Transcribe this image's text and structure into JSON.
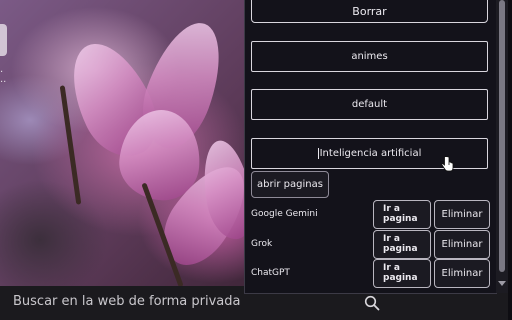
{
  "popup": {
    "borrar_label": "Borrar",
    "buttons": [
      "animes",
      "default",
      "Inteligencia artificial"
    ],
    "open_pages_label": "abrir paginas",
    "sites": [
      {
        "name": "Google Gemini",
        "go_label": "Ir a pagina",
        "delete_label": "Eliminar"
      },
      {
        "name": "Grok",
        "go_label": "Ir a pagina",
        "delete_label": "Eliminar"
      },
      {
        "name": "ChatGPT",
        "go_label": "Ir a pagina",
        "delete_label": "Eliminar"
      }
    ]
  },
  "search": {
    "placeholder": "Buscar en la web de forma privada"
  },
  "icons": {
    "search": "search-icon",
    "cursor": "hand-cursor-icon"
  },
  "colors": {
    "popup_bg": "#13121a",
    "search_bg": "#1b1a1e",
    "text": "#eceaf0"
  }
}
